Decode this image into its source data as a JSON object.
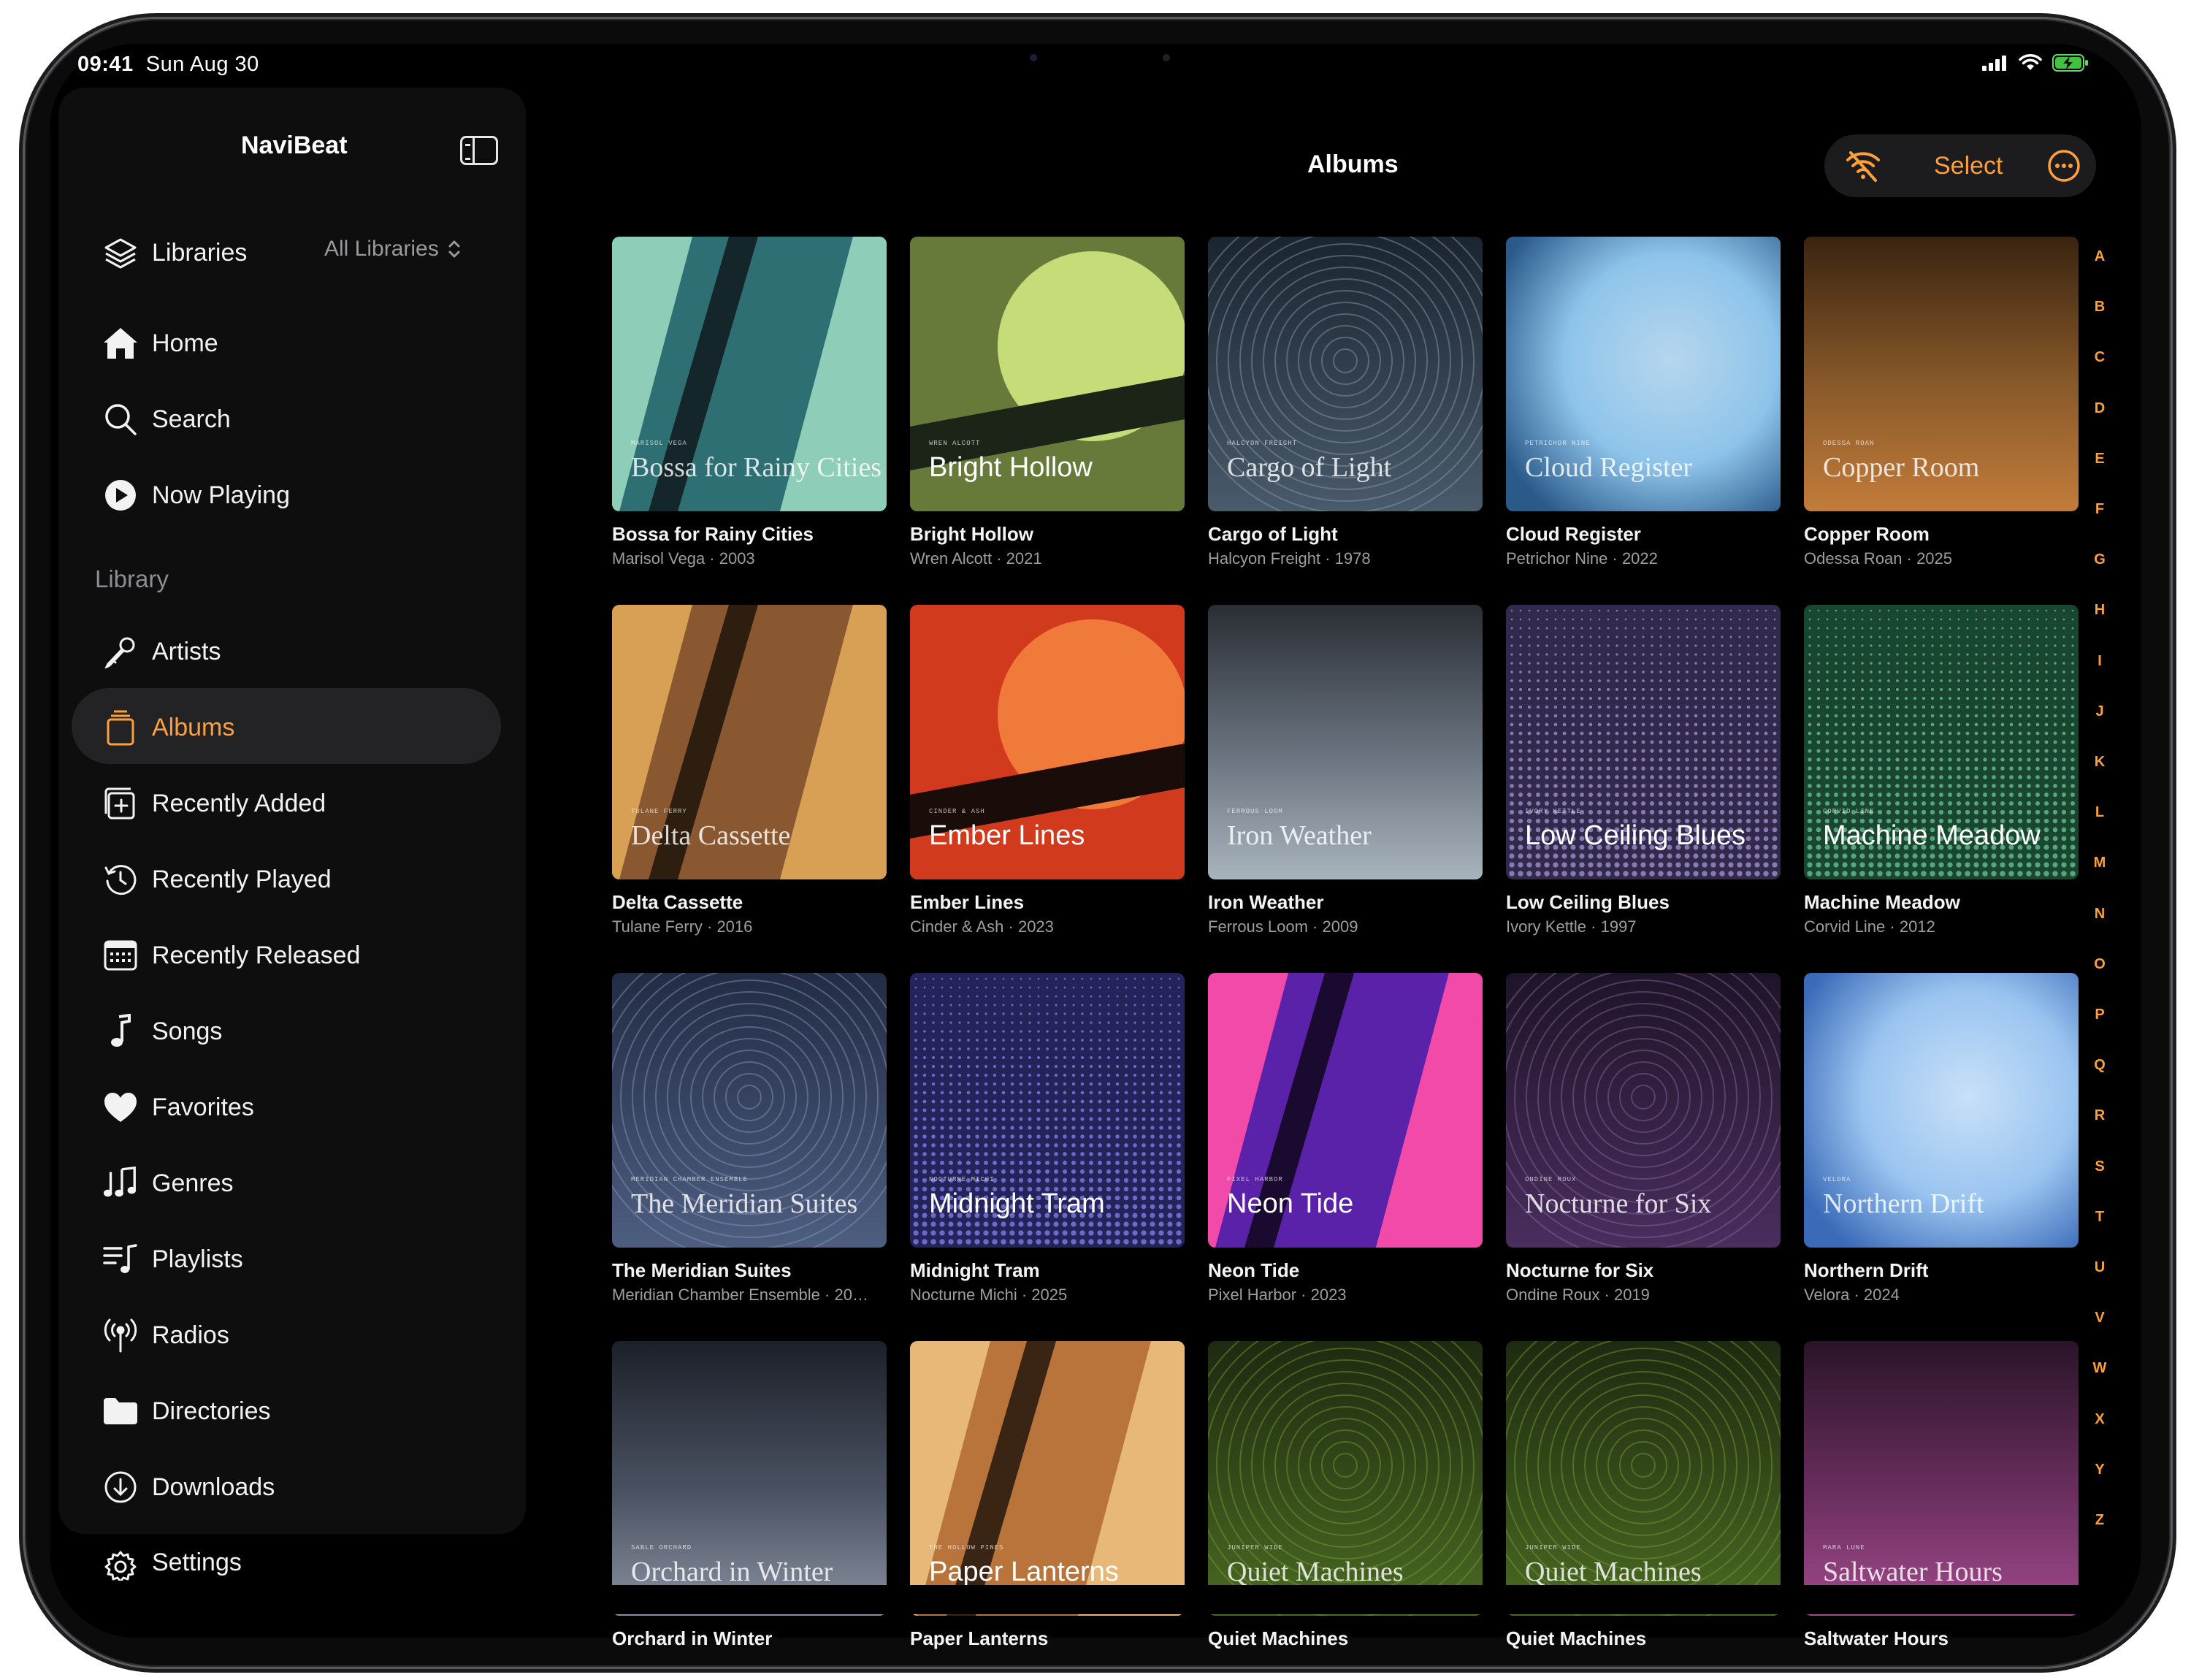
{
  "status_bar": {
    "time": "09:41",
    "date": "Sun Aug 30"
  },
  "sidebar": {
    "title": "NaviBeat",
    "libraries": {
      "label": "Libraries",
      "selected": "All Libraries"
    },
    "primary": [
      {
        "label": "Home",
        "icon": "house-icon"
      },
      {
        "label": "Search",
        "icon": "magnifier-icon"
      },
      {
        "label": "Now Playing",
        "icon": "play-circle-icon"
      }
    ],
    "section_label": "Library",
    "library_items": [
      {
        "label": "Artists",
        "icon": "microphone-icon"
      },
      {
        "label": "Albums",
        "icon": "album-stack-icon",
        "active": true
      },
      {
        "label": "Recently Added",
        "icon": "square-plus-icon"
      },
      {
        "label": "Recently Played",
        "icon": "history-clock-icon"
      },
      {
        "label": "Recently Released",
        "icon": "calendar-icon"
      },
      {
        "label": "Songs",
        "icon": "music-note-icon"
      },
      {
        "label": "Favorites",
        "icon": "heart-icon"
      },
      {
        "label": "Genres",
        "icon": "music-notes-icon"
      },
      {
        "label": "Playlists",
        "icon": "playlist-icon"
      },
      {
        "label": "Radios",
        "icon": "antenna-icon"
      },
      {
        "label": "Directories",
        "icon": "folder-icon"
      },
      {
        "label": "Downloads",
        "icon": "download-circle-icon"
      },
      {
        "label": "Settings",
        "icon": "gear-icon"
      }
    ]
  },
  "header": {
    "title": "Albums",
    "select_label": "Select"
  },
  "colors": {
    "accent": "#ff9f3a",
    "background": "#000000",
    "sidebar": "#0e0e0f"
  },
  "albums": [
    {
      "title": "Bossa for Rainy Cities",
      "sub": "Marisol Vega · 2003",
      "cover_artist": "Marisol Vega",
      "style": "stripes",
      "c": [
        "#8ecdb8",
        "#2e6f73",
        "#15262b"
      ]
    },
    {
      "title": "Bright Hollow",
      "sub": "Wren Alcott · 2021",
      "cover_artist": "Wren Alcott",
      "style": "sun",
      "c": [
        "#677a3a",
        "#c5dc78",
        "#1c2418"
      ]
    },
    {
      "title": "Cargo of Light",
      "sub": "Halcyon Freight · 1978",
      "cover_artist": "Halcyon Freight",
      "style": "rings",
      "c": [
        "#1a2530",
        "#4a5a6a",
        "#8aa0b0"
      ]
    },
    {
      "title": "Cloud Register",
      "sub": "Petrichor Nine · 2022",
      "cover_artist": "Petrichor Nine",
      "style": "blur",
      "c": [
        "#2a5a8a",
        "#8ec4ea",
        "#b6d6ee"
      ]
    },
    {
      "title": "Copper Room",
      "sub": "Odessa Roan · 2025",
      "cover_artist": "Odessa Roan",
      "style": "gradient",
      "c": [
        "#3a2410",
        "#8a5a2a",
        "#c27c3a"
      ]
    },
    {
      "title": "Delta Cassette",
      "sub": "Tulane Ferry · 2016",
      "cover_artist": "Tulane Ferry",
      "style": "stripes",
      "c": [
        "#d8a055",
        "#8a5830",
        "#2e1e10"
      ]
    },
    {
      "title": "Ember Lines",
      "sub": "Cinder & Ash · 2023",
      "cover_artist": "Cinder & Ash",
      "style": "sun",
      "c": [
        "#d23a1e",
        "#f07a3a",
        "#1a0c08"
      ]
    },
    {
      "title": "Iron Weather",
      "sub": "Ferrous Loom · 2009",
      "cover_artist": "Ferrous Loom",
      "style": "gradient",
      "c": [
        "#2a2e34",
        "#6a7480",
        "#a8b4bc"
      ]
    },
    {
      "title": "Low Ceiling Blues",
      "sub": "Ivory Kettle · 1997",
      "cover_artist": "Ivory Kettle",
      "style": "dots",
      "c": [
        "#1e1a30",
        "#5a4a80",
        "#8a78b0"
      ]
    },
    {
      "title": "Machine Meadow",
      "sub": "Corvid Line · 2012",
      "cover_artist": "Corvid Line",
      "style": "dots",
      "c": [
        "#0e2a1e",
        "#2e7a54",
        "#56a67a"
      ]
    },
    {
      "title": "The Meridian Suites",
      "sub": "Meridian Chamber Ensemble · 20…",
      "cover_artist": "Meridian Chamber Ensemble",
      "style": "rings",
      "c": [
        "#222c44",
        "#4e5e80",
        "#8a9ac0"
      ]
    },
    {
      "title": "Midnight Tram",
      "sub": "Nocturne Michi · 2025",
      "cover_artist": "Nocturne Michi",
      "style": "dots",
      "c": [
        "#1a1a40",
        "#3a3a90",
        "#6a6ac8"
      ]
    },
    {
      "title": "Neon Tide",
      "sub": "Pixel Harbor · 2023",
      "cover_artist": "Pixel Harbor",
      "style": "stripes",
      "c": [
        "#f24aa8",
        "#5a22a8",
        "#1a0a30"
      ]
    },
    {
      "title": "Nocturne for Six",
      "sub": "Ondine Roux · 2019",
      "cover_artist": "Ondine Roux",
      "style": "rings",
      "c": [
        "#1e1428",
        "#4a2e5e",
        "#8a6aa0"
      ]
    },
    {
      "title": "Northern Drift",
      "sub": "Velora · 2024",
      "cover_artist": "Velora",
      "style": "blur",
      "c": [
        "#3a6ab8",
        "#9ac4f0",
        "#c8e0f8"
      ]
    },
    {
      "title": "Orchard in Winter",
      "sub": "",
      "cover_artist": "Sable Orchard",
      "style": "gradient",
      "c": [
        "#1c2028",
        "#4a5262",
        "#8a92a2"
      ]
    },
    {
      "title": "Paper Lanterns",
      "sub": "",
      "cover_artist": "The Hollow Pines",
      "style": "stripes",
      "c": [
        "#e8b878",
        "#b8743a",
        "#3a2414"
      ]
    },
    {
      "title": "Quiet Machines",
      "sub": "",
      "cover_artist": "Juniper Wide",
      "style": "rings",
      "c": [
        "#1e2a10",
        "#4a6a22",
        "#7aa03a"
      ]
    },
    {
      "title": "Quiet Machines",
      "sub": "",
      "cover_artist": "Juniper Wide",
      "style": "rings",
      "c": [
        "#1e2a10",
        "#4a6a22",
        "#7aa03a"
      ]
    },
    {
      "title": "Saltwater Hours",
      "sub": "",
      "cover_artist": "Mara Lune",
      "style": "gradient",
      "c": [
        "#2a1428",
        "#6a2e5e",
        "#a04a8a"
      ]
    }
  ],
  "alphabet": [
    "A",
    "B",
    "C",
    "D",
    "E",
    "F",
    "G",
    "H",
    "I",
    "J",
    "K",
    "L",
    "M",
    "N",
    "O",
    "P",
    "Q",
    "R",
    "S",
    "T",
    "U",
    "V",
    "W",
    "X",
    "Y",
    "Z"
  ]
}
